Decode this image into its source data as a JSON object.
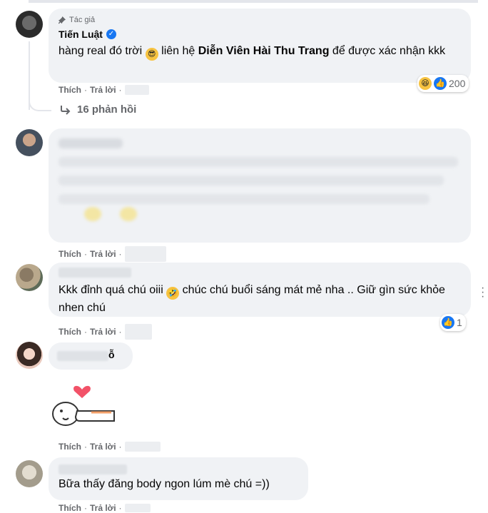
{
  "comment1": {
    "author_badge": "Tác giả",
    "name": "Tiến Luật",
    "text_before": "hàng real đó trời",
    "text_mid": " liên hệ ",
    "text_bold": "Diễn Viên Hài Thu Trang",
    "text_after": " để được xác nhận kkk",
    "reaction_count": "200",
    "like_label": "Thích",
    "reply_label": "Trả lời",
    "replies_label": "16 phản hồi"
  },
  "comment2": {
    "like_label": "Thích",
    "reply_label": "Trả lời"
  },
  "comment3": {
    "text_a": "Kkk đỉnh quá chú oiii",
    "text_b": " chúc chú buổi sáng mát mẻ nha .. Giữ gìn sức khỏe nhen chú",
    "reaction_count": "1",
    "like_label": "Thích",
    "reply_label": "Trả lời",
    "name_visible_part": "ỗ"
  },
  "comment4": {
    "like_label": "Thích",
    "reply_label": "Trả lời"
  },
  "comment5": {
    "text": "Bữa thấy đăng body ngon lúm mè chú =))",
    "like_label": "Thích",
    "reply_label": "Trả lời"
  },
  "icons": [
    "pin-icon",
    "verified-icon",
    "sunglasses-emoji",
    "rofl-emoji",
    "haha-reaction-icon",
    "like-reaction-icon",
    "reply-arrow-icon",
    "more-options-icon",
    "heart-icon"
  ],
  "colors": {
    "accent": "#1877f2",
    "bubble": "#f0f2f5",
    "muted": "#65676b"
  }
}
